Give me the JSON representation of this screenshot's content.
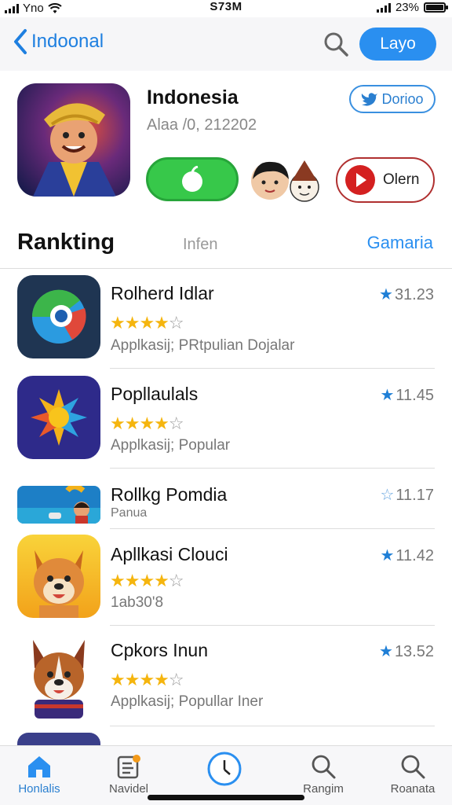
{
  "status_bar": {
    "carrier": "Yno",
    "time": "S73M",
    "battery": "23%"
  },
  "nav": {
    "back_label": "Indoonal",
    "primary_button": "Layo"
  },
  "featured": {
    "title": "Indonesia",
    "subtitle": "Alaa /0, 212202",
    "badge": "Dorioo",
    "play_label": "Olern"
  },
  "section": {
    "title": "Rankting",
    "middle": "Infen",
    "right_link": "Gamaria"
  },
  "apps": [
    {
      "name": "Rolherd Idlar",
      "stars": 4,
      "description": "Applkasij;  PRtpulian Dojalar",
      "rating": "31.23",
      "rating_star": "filled"
    },
    {
      "name": "Popllaulals",
      "stars": 4,
      "description": "Applkasij;  Popular",
      "rating": "11.45",
      "rating_star": "filled"
    },
    {
      "name": "Rollkg Pomdia",
      "stars": 0,
      "description": "Panua",
      "rating": "11.17",
      "rating_star": "hollow"
    },
    {
      "name": "Apllkasi Clouci",
      "stars": 4,
      "description": "1ab30'8",
      "rating": "11.42",
      "rating_star": "filled"
    },
    {
      "name": "Cpkors Inun",
      "stars": 4,
      "description": "Applkasij;  Popullar  Iner",
      "rating": "13.52",
      "rating_star": "filled"
    }
  ],
  "tabs": [
    {
      "label": "Honlalis",
      "icon": "home-icon",
      "active": true
    },
    {
      "label": "Navidel",
      "icon": "news-icon",
      "active": false
    },
    {
      "label": "",
      "icon": "compass-icon",
      "active": false
    },
    {
      "label": "Rangim",
      "icon": "search-icon",
      "active": false
    },
    {
      "label": "Roanata",
      "icon": "search-icon",
      "active": false
    }
  ],
  "colors": {
    "accent": "#2a8ff0",
    "star": "#f5b50e",
    "get_green": "#37c84a",
    "play_red": "#d42020"
  }
}
